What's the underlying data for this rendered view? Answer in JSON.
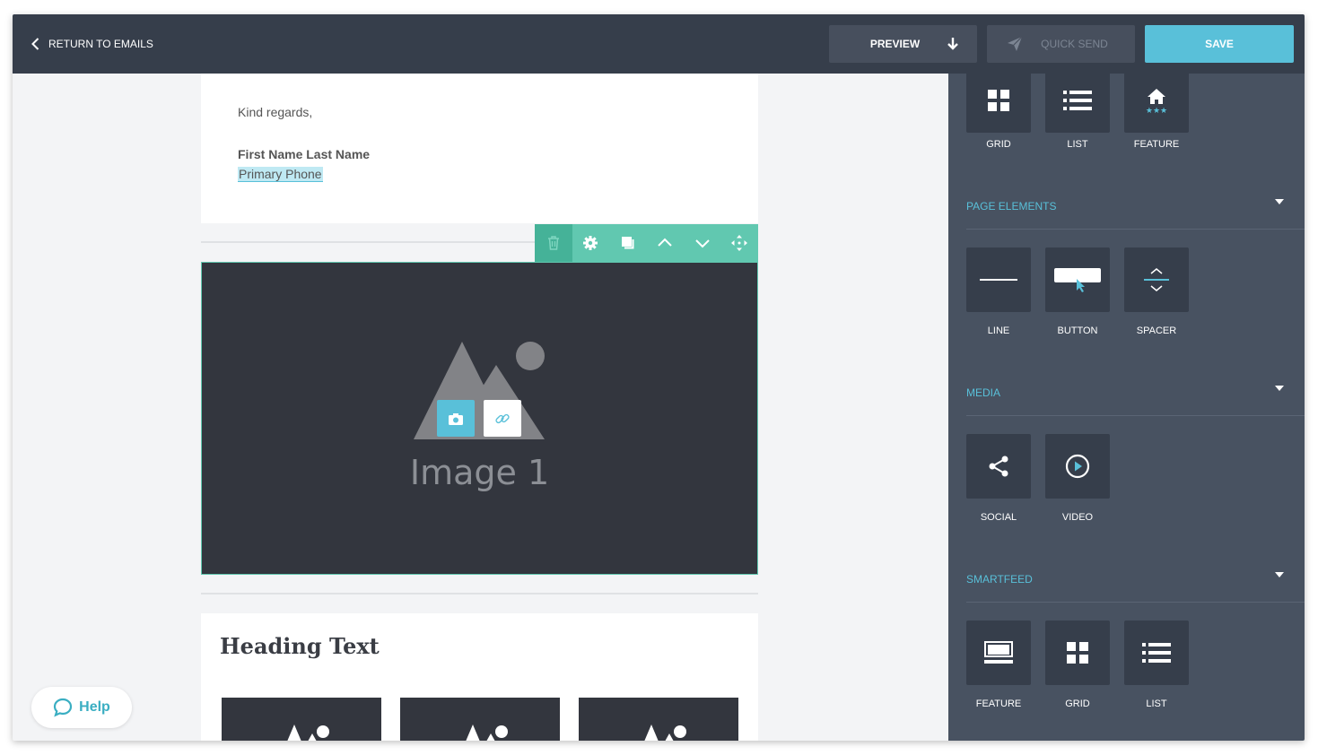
{
  "topbar": {
    "return_label": "RETURN TO EMAILS",
    "preview_label": "PREVIEW",
    "quick_send_label": "QUICK SEND",
    "save_label": "SAVE"
  },
  "canvas": {
    "closing": "Kind regards,",
    "signature_name": "First Name Last Name",
    "signature_phone": "Primary Phone",
    "image_label": "Image 1",
    "heading": "Heading Text"
  },
  "sidebar": {
    "layout_tiles": [
      {
        "label": "GRID",
        "icon": "grid-icon"
      },
      {
        "label": "LIST",
        "icon": "list-icon"
      },
      {
        "label": "FEATURE",
        "icon": "feature-home-icon"
      }
    ],
    "sections": [
      {
        "title": "PAGE ELEMENTS",
        "tiles": [
          {
            "label": "LINE",
            "icon": "line-icon"
          },
          {
            "label": "BUTTON",
            "icon": "button-icon"
          },
          {
            "label": "SPACER",
            "icon": "spacer-icon"
          }
        ]
      },
      {
        "title": "MEDIA",
        "tiles": [
          {
            "label": "SOCIAL",
            "icon": "share-icon"
          },
          {
            "label": "VIDEO",
            "icon": "play-icon"
          }
        ]
      },
      {
        "title": "SMARTFEED",
        "tiles": [
          {
            "label": "FEATURE",
            "icon": "feature-icon"
          },
          {
            "label": "GRID",
            "icon": "grid-icon"
          },
          {
            "label": "LIST",
            "icon": "list-icon"
          }
        ]
      }
    ]
  },
  "help_label": "Help",
  "colors": {
    "topbar": "#363e4b",
    "sidebar": "#485261",
    "accent_blue": "#59c0d9",
    "accent_green": "#61c8b0"
  }
}
